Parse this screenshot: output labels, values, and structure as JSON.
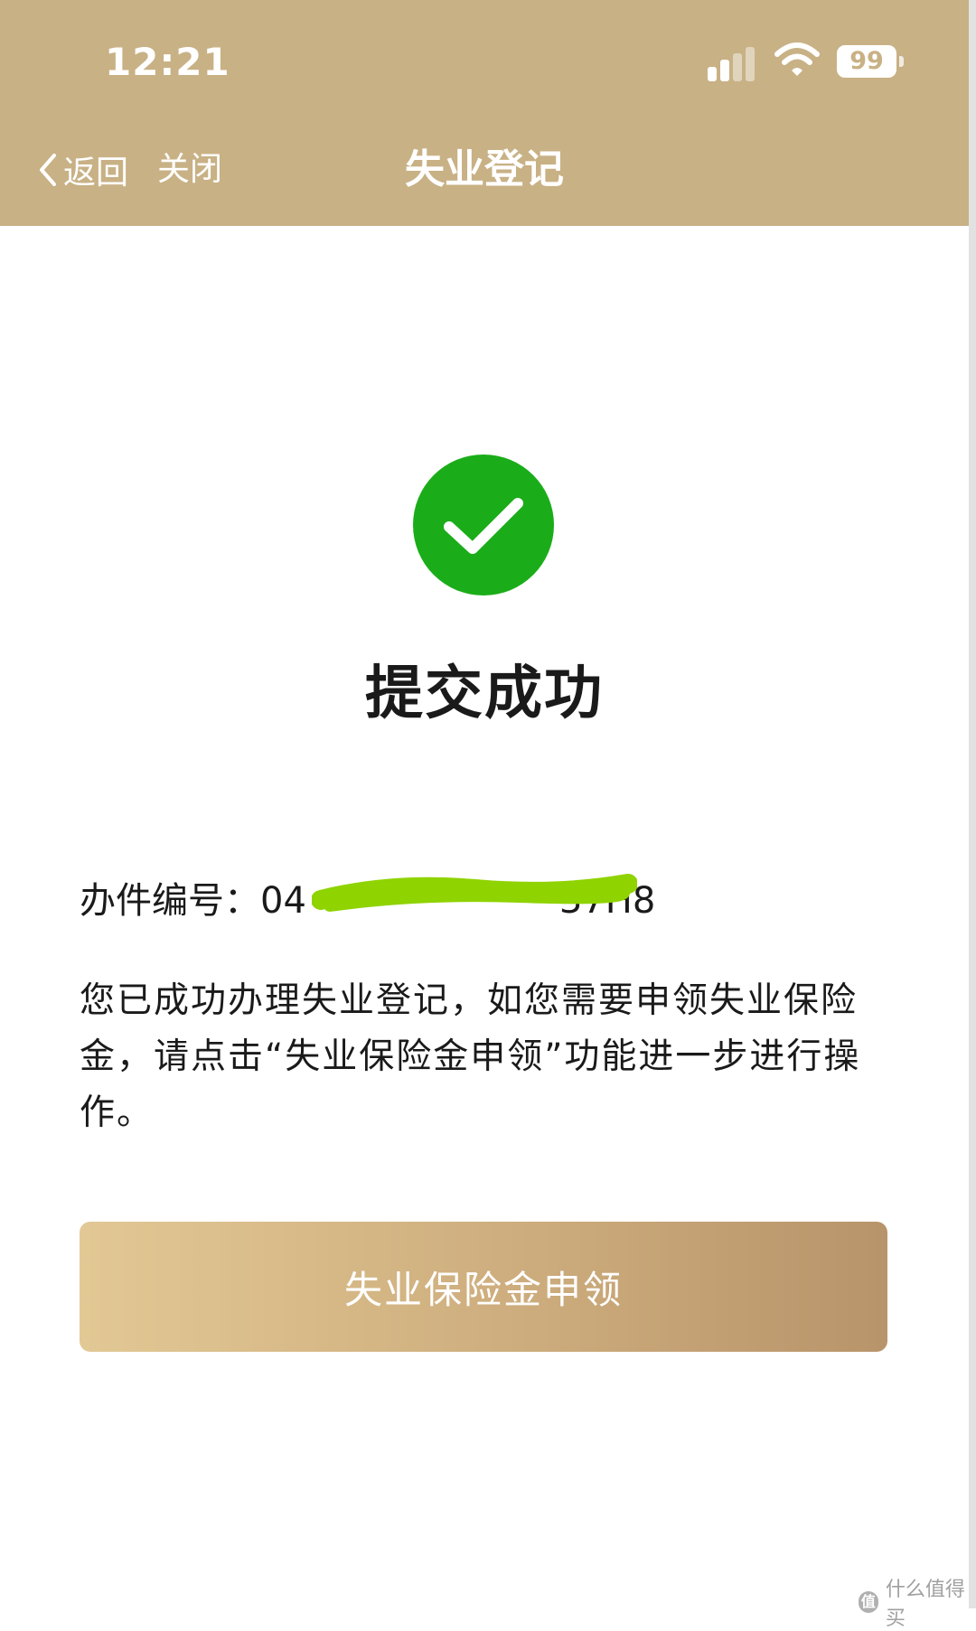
{
  "status_bar": {
    "time": "12:21",
    "battery_level": "99",
    "icons": [
      "signal-icon",
      "wifi-icon",
      "battery-icon"
    ]
  },
  "nav_bar": {
    "back_label": "返回",
    "close_label": "关闭",
    "title": "失业登记"
  },
  "result": {
    "icon": "check-circle-icon",
    "title": "提交成功"
  },
  "case": {
    "label": "办件编号：",
    "number_visible": "04",
    "number_suffix": "37H8"
  },
  "message": "您已成功办理失业登记，如您需要申领失业保险金，请点击“失业保险金申领”功能进一步进行操作。",
  "action_button": "失业保险金申领",
  "watermark": {
    "badge": "值",
    "text": "什么值得买"
  },
  "colors": {
    "header": "#c8b185",
    "success": "#1aad19",
    "button_start": "#e2c894",
    "button_end": "#b8946a",
    "redaction": "#8fd300"
  }
}
